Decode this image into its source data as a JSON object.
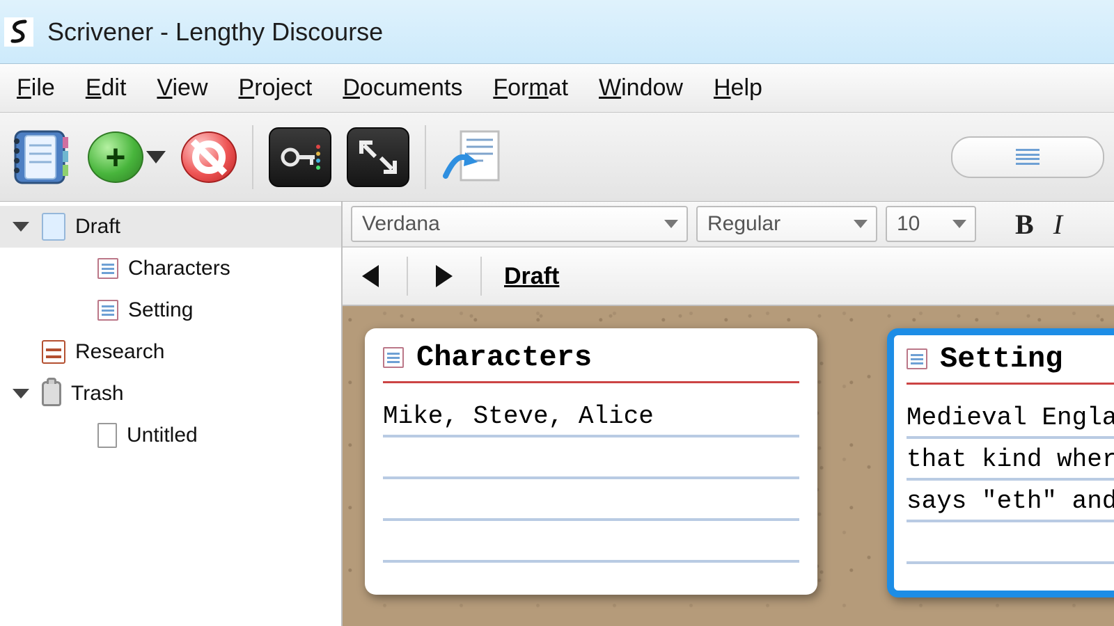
{
  "window": {
    "title": "Scrivener - Lengthy Discourse"
  },
  "menu": {
    "file": "File",
    "edit": "Edit",
    "view": "View",
    "project": "Project",
    "documents": "Documents",
    "format": "Format",
    "window": "Window",
    "help": "Help"
  },
  "format_bar": {
    "font": "Verdana",
    "style": "Regular",
    "size": "10"
  },
  "path": {
    "title": "Draft"
  },
  "binder": {
    "draft": "Draft",
    "characters": "Characters",
    "setting": "Setting",
    "research": "Research",
    "trash": "Trash",
    "untitled": "Untitled"
  },
  "cards": [
    {
      "title": "Characters",
      "body": "Mike, Steve, Alice"
    },
    {
      "title": "Setting",
      "body": "Medieval England, but not that kind where everyone says \"eth\" and \"Olde\" -- "
    }
  ]
}
